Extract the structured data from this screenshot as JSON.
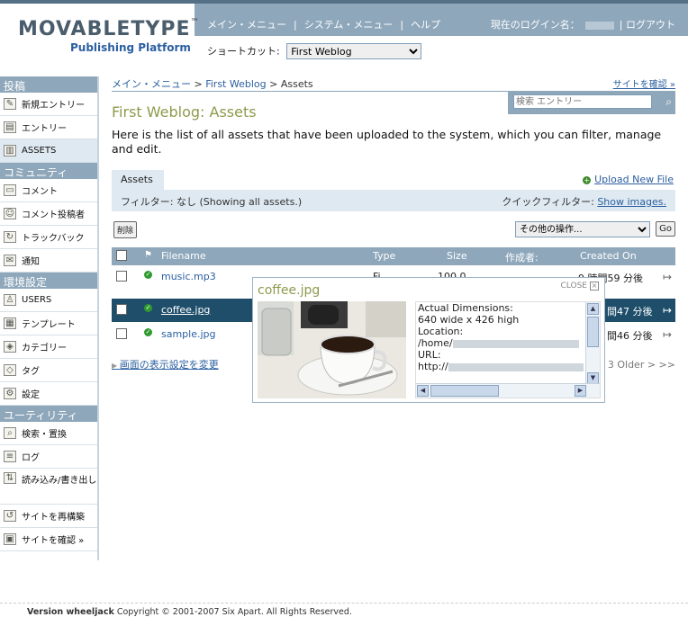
{
  "header": {
    "logo_text": "MOVABLETYPE",
    "logo_tm": "™",
    "logo_sub": "Publishing Platform",
    "nav": [
      "メイン・メニュー",
      "システム・メニュー",
      "ヘルプ"
    ],
    "login_label": "現在のログイン名：",
    "logout": "ログアウト",
    "shortcut_label": "ショートカット:",
    "shortcut_value": "First Weblog"
  },
  "sidebar": [
    {
      "type": "head",
      "label": "投稿"
    },
    {
      "type": "item",
      "label": "新規エントリー",
      "icon": "new-entry-icon",
      "glyph": "✎"
    },
    {
      "type": "item",
      "label": "エントリー",
      "icon": "entries-icon",
      "glyph": "▤"
    },
    {
      "type": "item",
      "label": "ASSETS",
      "icon": "assets-icon",
      "glyph": "▥",
      "active": true
    },
    {
      "type": "head",
      "label": "コミュニティ"
    },
    {
      "type": "item",
      "label": "コメント",
      "icon": "comment-icon",
      "glyph": "▭"
    },
    {
      "type": "item",
      "label": "コメント投稿者",
      "icon": "commenter-icon",
      "glyph": "☺"
    },
    {
      "type": "item",
      "label": "トラックバック",
      "icon": "trackback-icon",
      "glyph": "↻"
    },
    {
      "type": "item",
      "label": "通知",
      "icon": "notification-icon",
      "glyph": "✉"
    },
    {
      "type": "head",
      "label": "環境設定"
    },
    {
      "type": "item",
      "label": "USERS",
      "icon": "users-icon",
      "glyph": "♙"
    },
    {
      "type": "item",
      "label": "テンプレート",
      "icon": "template-icon",
      "glyph": "▦"
    },
    {
      "type": "item",
      "label": "カテゴリー",
      "icon": "category-icon",
      "glyph": "◈"
    },
    {
      "type": "item",
      "label": "タグ",
      "icon": "tag-icon",
      "glyph": "◇"
    },
    {
      "type": "item",
      "label": "設定",
      "icon": "settings-icon",
      "glyph": "⚙"
    },
    {
      "type": "head",
      "label": "ユーティリティ"
    },
    {
      "type": "item",
      "label": "検索・置換",
      "icon": "search-icon",
      "glyph": "⌕"
    },
    {
      "type": "item",
      "label": "ログ",
      "icon": "log-icon",
      "glyph": "≡"
    },
    {
      "type": "item",
      "label": "読み込み/書き出し",
      "icon": "import-export-icon",
      "glyph": "⇅",
      "tall": true
    },
    {
      "type": "item",
      "label": "サイトを再構築",
      "icon": "rebuild-icon",
      "glyph": "↺"
    },
    {
      "type": "item",
      "label": "サイトを確認 »",
      "icon": "view-site-icon",
      "glyph": "▣"
    }
  ],
  "main": {
    "breadcrumb": {
      "home": "メイン・メニュー",
      "blog": "First Weblog",
      "current": "Assets",
      "sep": " > "
    },
    "view_site": "サイトを確認 »",
    "search_placeholder": "検索 エントリー",
    "title": "First Weblog: Assets",
    "description": "Here is the list of all assets that have been uploaded to the system, which you can filter, manage and edit.",
    "tab": "Assets",
    "upload": "Upload New File",
    "filter_label": "フィルター: なし",
    "filter_note": "(Showing all assets.)",
    "quick_label": "クイックフィルター:",
    "quick_link": "Show images.",
    "delete_btn": "削除",
    "actions_select": "その他の操作...",
    "go_btn": "Go",
    "columns": {
      "filename": "Filename",
      "type": "Type",
      "size": "Size",
      "author": "作成者:",
      "created": "Created On"
    },
    "rows": [
      {
        "filename": "music.mp3",
        "type": "Fi",
        "size": "100.0",
        "created": "9 時間59 分後"
      },
      {
        "filename": "coffee.jpg",
        "created": "間47 分後",
        "selected": true
      },
      {
        "filename": "sample.jpg",
        "created": "間46 分後"
      }
    ],
    "display_settings": "画面の表示設定を変更",
    "pager": "3  Older > >>"
  },
  "popup": {
    "title": "coffee.jpg",
    "close": "CLOSE",
    "dimensions_label": "Actual Dimensions:",
    "dimensions_value": "640 wide x 426 high",
    "location_label": "Location:",
    "location_value": "/home/",
    "url_label": "URL:",
    "url_value": "http://"
  },
  "footer": {
    "version": "Version wheeljack",
    "copyright": "Copyright © 2001-2007 Six Apart. All Rights Reserved."
  },
  "colors": {
    "band": "#8ea7bb",
    "accent": "#2b5fa0",
    "title": "#8e9a4c",
    "selected_row": "#1f4e6b"
  }
}
